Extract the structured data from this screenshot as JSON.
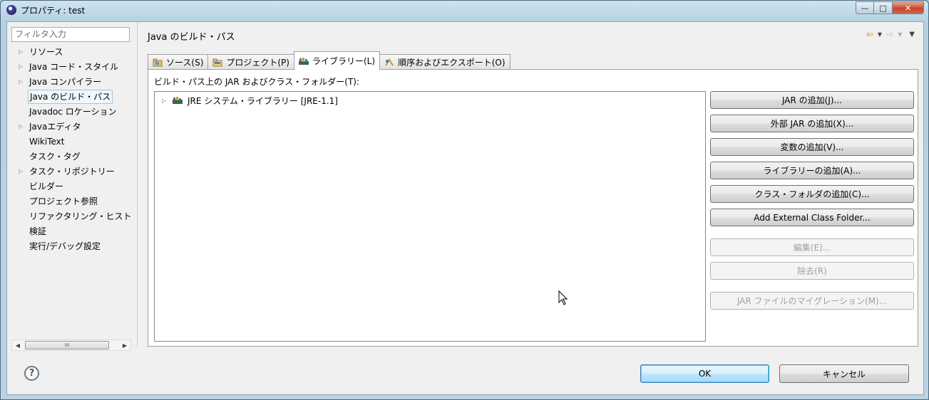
{
  "window": {
    "title": "プロパティ: test"
  },
  "filter": {
    "placeholder": "フィルタ入力"
  },
  "left_tree": [
    {
      "label": "リソース",
      "expandable": true
    },
    {
      "label": "Java コード・スタイル",
      "expandable": true
    },
    {
      "label": "Java コンパイラー",
      "expandable": true
    },
    {
      "label": "Java のビルド・パス",
      "expandable": false,
      "selected": true
    },
    {
      "label": "Javadoc ロケーション",
      "expandable": false
    },
    {
      "label": "Javaエディタ",
      "expandable": true
    },
    {
      "label": "WikiText",
      "expandable": false
    },
    {
      "label": "タスク・タグ",
      "expandable": false
    },
    {
      "label": "タスク・リポジトリー",
      "expandable": true
    },
    {
      "label": "ビルダー",
      "expandable": false
    },
    {
      "label": "プロジェクト参照",
      "expandable": false
    },
    {
      "label": "リファクタリング・ヒスト",
      "expandable": false
    },
    {
      "label": "検証",
      "expandable": false
    },
    {
      "label": "実行/デバッグ設定",
      "expandable": false
    }
  ],
  "page": {
    "title": "Java のビルド・パス"
  },
  "tabs": [
    {
      "label": "ソース(S)",
      "icon": "source-folder-icon",
      "active": false
    },
    {
      "label": "プロジェクト(P)",
      "icon": "project-folder-icon",
      "active": false
    },
    {
      "label": "ライブラリー(L)",
      "icon": "library-icon",
      "active": true
    },
    {
      "label": "順序およびエクスポート(O)",
      "icon": "order-export-icon",
      "active": false
    }
  ],
  "panel": {
    "label": "ビルド・パス上の JAR およびクラス・フォルダー(T):",
    "entries": [
      {
        "label": "JRE システム・ライブラリー [JRE-1.1]",
        "icon": "library-icon"
      }
    ]
  },
  "buttons": [
    {
      "label": "JAR の追加(J)...",
      "enabled": true
    },
    {
      "label": "外部 JAR の追加(X)...",
      "enabled": true
    },
    {
      "label": "変数の追加(V)...",
      "enabled": true
    },
    {
      "label": "ライブラリーの追加(A)...",
      "enabled": true
    },
    {
      "label": "クラス・フォルダの追加(C)...",
      "enabled": true
    },
    {
      "label": "Add External Class Folder...",
      "enabled": true
    },
    {
      "label": "編集(E)...",
      "enabled": false
    },
    {
      "label": "除去(R)",
      "enabled": false
    },
    {
      "label": "JAR ファイルのマイグレーション(M)...",
      "enabled": false
    }
  ],
  "footer": {
    "help": "?",
    "ok": "OK",
    "cancel": "キャンセル"
  },
  "scrollbar": {
    "thumb_glyph": "III"
  },
  "colors": {
    "accent_ok": "#3c7fb1",
    "selection": "#9ec6e3",
    "back_arrow": "#d8a020"
  }
}
